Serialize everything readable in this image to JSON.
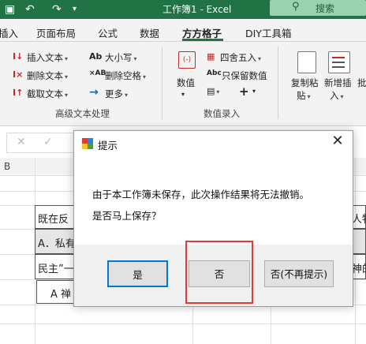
{
  "titlebar": {
    "window_title": "工作簿1  -  Excel",
    "search_label": "搜索",
    "search_icon": "search-icon",
    "qa_icons": [
      "save-icon",
      "undo-icon",
      "redo-icon",
      "customize-icon"
    ]
  },
  "tabs": [
    {
      "label": "插入",
      "active": false
    },
    {
      "label": "页面布局",
      "active": false
    },
    {
      "label": "公式",
      "active": false
    },
    {
      "label": "数据",
      "active": false
    },
    {
      "label": "方方格子",
      "active": true
    },
    {
      "label": "DIY工具箱",
      "active": false
    }
  ],
  "ribbon": {
    "text_group": {
      "insert_text": "插入文本",
      "delete_text": "删除文本",
      "extract_text": "截取文本",
      "case": "大小写",
      "delete_space": "删除空格",
      "more": "更多",
      "label": "高级文本处理"
    },
    "number_group": {
      "numeric": "数值",
      "round": "四舍五入",
      "keep_numeric": "只保留数值",
      "plus": "+",
      "label": "数值录入"
    },
    "copy_group": {
      "copy_paste_1": "复制粘",
      "copy_paste_2": "贴",
      "add_insert_1": "新增插",
      "add_insert_2": "入",
      "batch": "批"
    }
  },
  "grid": {
    "col_b": "B",
    "cells": {
      "r1_left": "既在反",
      "r1_right": "人物",
      "r2_left": "A．私有",
      "r3_left": "民主”一",
      "r3_right": "神的",
      "r4_left": "A 禅"
    }
  },
  "dialog": {
    "title": "提示",
    "message_line1": "由于本工作簿未保存，此次操作结果将无法撤销。",
    "message_line2": "是否马上保存？",
    "buttons": {
      "yes": "是",
      "no": "否",
      "no_prompt": "否(不再提示)"
    }
  }
}
